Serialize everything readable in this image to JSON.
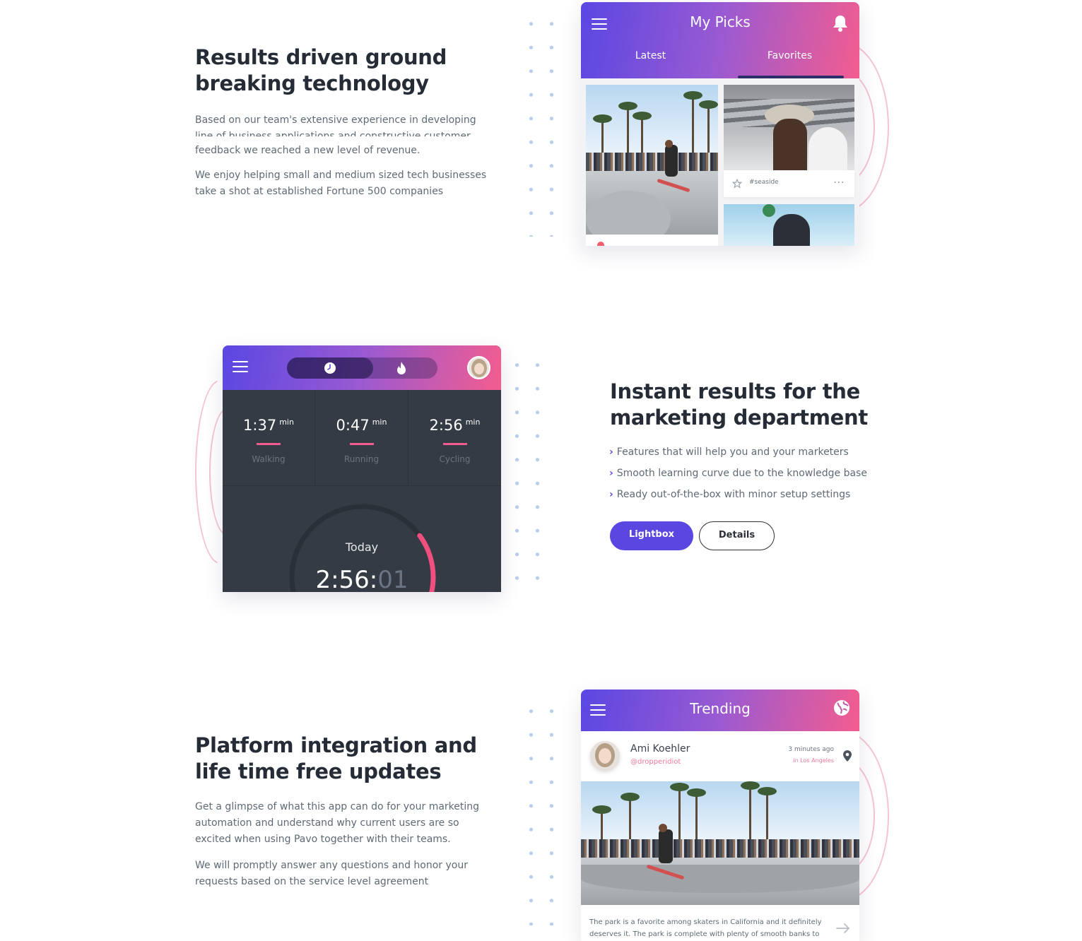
{
  "section1": {
    "heading_line1": "Results driven ground",
    "heading_line2": "breaking technology",
    "para1_line1": "Based on our team's extensive experience in developing",
    "para1_line2": "line of business applications and constructive customer",
    "para1_line3": "feedback we reached a new level of revenue.",
    "para2_line1": "We enjoy helping small and medium sized tech businesses",
    "para2_line2": "take a shot at established Fortune 500 companies",
    "phone": {
      "title": "My Picks",
      "tabs": [
        {
          "label": "Latest",
          "active": false
        },
        {
          "label": "Favorites",
          "active": true
        }
      ],
      "card_tag": "#seaside",
      "card_more": "⋯"
    }
  },
  "section2": {
    "heading_line1": "Instant results for the",
    "heading_line2": "marketing department",
    "features": [
      "Features that will help you and your marketers",
      "Smooth learning curve due to the knowledge base",
      "Ready out-of-the-box with minor setup settings"
    ],
    "buttons": {
      "primary": "Lightbox",
      "secondary": "Details"
    },
    "phone": {
      "stats": [
        {
          "value": "1:37",
          "unit": "min",
          "label": "Walking"
        },
        {
          "value": "0:47",
          "unit": "min",
          "label": "Running"
        },
        {
          "value": "2:56",
          "unit": "min",
          "label": "Cycling"
        }
      ],
      "today_label": "Today",
      "today_time_main": "2:56:",
      "today_time_secs": "01",
      "progress": 0.35
    }
  },
  "section3": {
    "heading_line1": "Platform integration and",
    "heading_line2": "life time free updates",
    "para1_line1": "Get a glimpse of what this app can do for your marketing",
    "para1_line2": "automation and understand why current users are so",
    "para1_line3": "excited when using Pavo together with their teams.",
    "para2_line1": "We will promptly answer any questions and honor your",
    "para2_line2": "requests based on the service level agreement",
    "phone": {
      "title": "Trending",
      "user_name": "Ami Koehler",
      "user_handle": "@dropperidiot",
      "time_ago": "3 minutes ago",
      "location": "in Los Angeles",
      "caption_line1": "The park is a favorite among skaters in California and it definitely",
      "caption_line2": "deserves it. The park is complete with plenty of smooth banks to"
    }
  },
  "colors": {
    "accent": "#5a47e2",
    "pink": "#f35c8f",
    "heading": "#252c36",
    "body_text": "#5f6a76",
    "dark_panel": "#353b44"
  },
  "icons": [
    "menu-icon",
    "bell-icon",
    "star-icon",
    "clock-icon",
    "flame-icon",
    "globe-icon",
    "location-pin-icon",
    "arrow-right-icon",
    "chevron-right-icon"
  ]
}
